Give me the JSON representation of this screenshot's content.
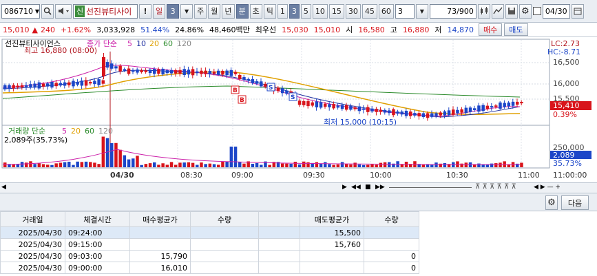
{
  "toolbar": {
    "stock_code": "086710",
    "stock_badge": "신",
    "stock_name": "선진뷰티사이",
    "period_day": "일",
    "period_value": "3",
    "periods": [
      "주",
      "월",
      "년",
      "분",
      "초",
      "틱"
    ],
    "active_period": "분",
    "minutes": [
      "1",
      "3",
      "5",
      "10",
      "15",
      "30",
      "45",
      "60"
    ],
    "active_minute": "3",
    "count_value": "3",
    "range_value": "73",
    "range_total": "/900",
    "date_value": "04/30"
  },
  "price_row": {
    "price": "15,010",
    "change": "240",
    "change_pct": "+1.62%",
    "volume": "3,033,928",
    "pct1": "51.44%",
    "pct2": "24.86%",
    "amount": "48,460백만",
    "best_label": "최우선",
    "best_ask": "15,030",
    "best_bid": "15,010",
    "open_label": "시",
    "open": "16,580",
    "high_label": "고",
    "high": "16,880",
    "low_label": "저",
    "low": "14,870",
    "buy_label": "매수",
    "sell_label": "매도"
  },
  "chart": {
    "legend_name": "선진뷰티사이언스",
    "legend_ma_label": "종가 단순",
    "ma_periods": [
      "5",
      "10",
      "20",
      "60",
      "120"
    ],
    "high_annotation": "최고 16,880 (08:00)",
    "low_annotation": "최저 15,000 (10:15)",
    "lc_label": "LC:2.73",
    "hc_label": "HC:-8.71",
    "price_ticks": [
      "16,500",
      "16,000",
      "15,500"
    ],
    "current_price_tag": "15,410",
    "current_pct_tag": "0.39%",
    "volume_legend": "거래량 단순",
    "volume_ma_periods": [
      "5",
      "20",
      "60",
      "120"
    ],
    "volume_value": "2,089주(35.73%)",
    "volume_ticks": [
      "250,000"
    ],
    "current_volume_tag": "2,089",
    "current_volume_pct": "35.73%",
    "time_labels": [
      "04/30",
      "08:30",
      "09:00",
      "09:30",
      "10:00",
      "10:30",
      "11:00"
    ],
    "time_axis_end": "11:00:00",
    "marker_labels": [
      "B",
      "S"
    ],
    "colors": {
      "up": "#d8141b",
      "down": "#1c46c8",
      "ma5": "#cc22aa",
      "ma10": "#2030a0",
      "ma20": "#e0a000",
      "ma60": "#2a8a2a"
    }
  },
  "grid_toolbar": {
    "next_label": "다음"
  },
  "orders": {
    "headers": [
      "거래일",
      "체결시간",
      "매수평균가",
      "수량",
      "",
      "매도평균가",
      "수량"
    ],
    "rows": [
      {
        "date": "2025/04/30",
        "time": "09:24:00",
        "buy_avg": "",
        "buy_qty": "",
        "sell_avg": "15,500",
        "sell_qty": ""
      },
      {
        "date": "2025/04/30",
        "time": "09:15:00",
        "buy_avg": "",
        "buy_qty": "",
        "sell_avg": "15,760",
        "sell_qty": ""
      },
      {
        "date": "2025/04/30",
        "time": "09:03:00",
        "buy_avg": "15,790",
        "buy_qty": "",
        "sell_avg": "",
        "sell_qty": "0"
      },
      {
        "date": "2025/04/30",
        "time": "09:00:00",
        "buy_avg": "16,010",
        "buy_qty": "",
        "sell_avg": "",
        "sell_qty": "0"
      }
    ]
  }
}
